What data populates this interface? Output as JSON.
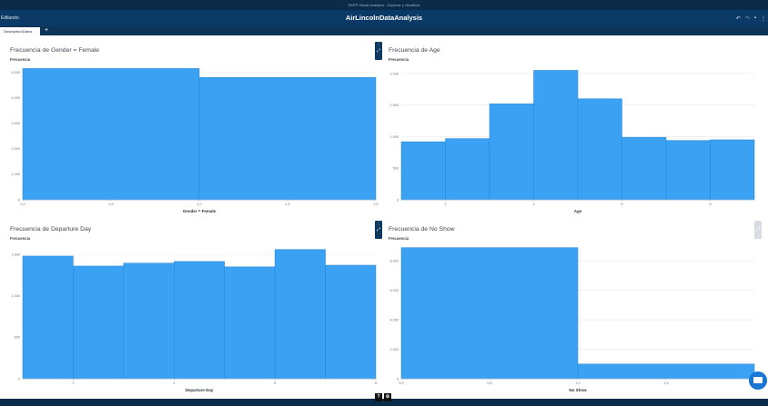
{
  "topbar": {
    "text": "SAP® Visual Analytics - Explorar y visualizar"
  },
  "appbar": {
    "mode": "Editando",
    "title": "AirLincolnDataAnalysis"
  },
  "tabs": [
    {
      "label": "Descriptivo/Datos"
    }
  ],
  "add_tab": "+",
  "bottom": {
    "help": "?",
    "settings": "⚙"
  },
  "colors": {
    "bar": "#3ba1f2",
    "bar_edge": "#2a86d4",
    "grid": "#e4e8ec",
    "header": "#0b3a66"
  },
  "panels": [
    {
      "title": "Frecuencia de Gender = Female",
      "ylabel": "Frecuencia",
      "chart_data": {
        "type": "bar",
        "title": "Frecuencia de Gender = Female",
        "xlabel": "Gender = Female",
        "ylabel": "Frecuencia",
        "bins": [
          [
            0,
            1,
            5150
          ],
          [
            1,
            2,
            4800
          ]
        ],
        "xlim": [
          0,
          2
        ],
        "ylim": [
          0,
          5200
        ],
        "xticks": [
          "0,0",
          "0,5",
          "1,0",
          "1,5",
          "2,0"
        ],
        "yticks": [
          "0",
          "1.000",
          "2.000",
          "3.000",
          "4.000",
          "5.000"
        ],
        "grid": true
      }
    },
    {
      "title": "Frecuencia de Age",
      "ylabel": "Frecuencia",
      "chart_data": {
        "type": "bar",
        "title": "Frecuencia de Age",
        "xlabel": "Age",
        "ylabel": "Frecuencia",
        "bins": [
          [
            0,
            1,
            920
          ],
          [
            1,
            2,
            970
          ],
          [
            2,
            3,
            1520
          ],
          [
            3,
            4,
            2050
          ],
          [
            4,
            5,
            1600
          ],
          [
            5,
            6,
            990
          ],
          [
            6,
            7,
            940
          ],
          [
            7,
            8,
            950
          ]
        ],
        "xlim": [
          0,
          8
        ],
        "ylim": [
          0,
          2100
        ],
        "xticks": [
          "2",
          "4",
          "6",
          "8"
        ],
        "xtick_vals": [
          1,
          3,
          5,
          7
        ],
        "yticks": [
          "0",
          "500",
          "1.000",
          "1.500",
          "2.000"
        ],
        "grid": true
      }
    },
    {
      "title": "Frecuencia de Departure Day",
      "ylabel": "Frecuencia",
      "chart_data": {
        "type": "bar",
        "title": "Frecuencia de Departure Day",
        "xlabel": "Departure Day",
        "ylabel": "Frecuencia",
        "bins": [
          [
            0,
            1,
            1480
          ],
          [
            1,
            2,
            1360
          ],
          [
            2,
            3,
            1395
          ],
          [
            3,
            4,
            1415
          ],
          [
            4,
            5,
            1350
          ],
          [
            5,
            6,
            1560
          ],
          [
            6,
            7,
            1370
          ]
        ],
        "xlim": [
          0,
          7
        ],
        "ylim": [
          0,
          1600
        ],
        "xticks": [
          "2",
          "4",
          "6",
          "8"
        ],
        "xtick_vals": [
          1,
          3,
          5,
          7
        ],
        "yticks": [
          "0",
          "500",
          "1.000",
          "1.500"
        ],
        "grid": true
      }
    },
    {
      "title": "Frecuencia de No Show",
      "ylabel": "Frecuencia",
      "chart_data": {
        "type": "bar",
        "title": "Frecuencia de No Show",
        "xlabel": "No Show",
        "ylabel": "Frecuencia",
        "bins": [
          [
            0,
            1,
            8900
          ],
          [
            1,
            2,
            1000
          ]
        ],
        "xlim": [
          0,
          2
        ],
        "ylim": [
          0,
          9000
        ],
        "xticks": [
          "0,0",
          "0,5",
          "1,0",
          "1,5"
        ],
        "xtick_vals": [
          0,
          0.5,
          1,
          1.5
        ],
        "yticks": [
          "0",
          "2.000",
          "4.000",
          "6.000",
          "8.000"
        ],
        "grid": true
      }
    }
  ]
}
